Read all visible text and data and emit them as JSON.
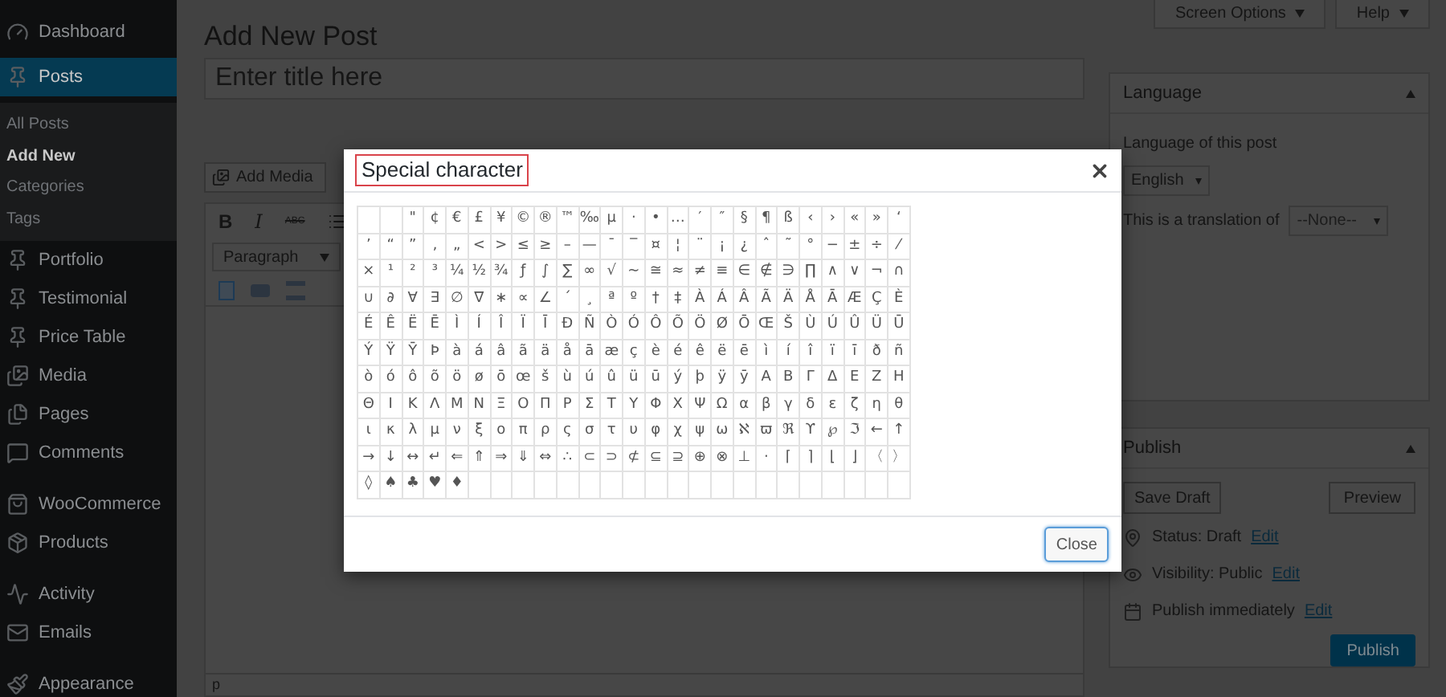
{
  "sidebar": {
    "items": [
      {
        "label": "Dashboard",
        "selected": false
      },
      {
        "label": "Posts",
        "selected": true,
        "children": [
          {
            "label": "All Posts",
            "selected": false
          },
          {
            "label": "Add New",
            "selected": true
          },
          {
            "label": "Categories",
            "selected": false
          },
          {
            "label": "Tags",
            "selected": false
          }
        ]
      },
      {
        "label": "Portfolio",
        "selected": false
      },
      {
        "label": "Testimonial",
        "selected": false
      },
      {
        "label": "Price Table",
        "selected": false
      },
      {
        "label": "Media",
        "selected": false
      },
      {
        "label": "Pages",
        "selected": false
      },
      {
        "label": "Comments",
        "selected": false
      },
      {
        "label": "WooCommerce",
        "selected": false
      },
      {
        "label": "Products",
        "selected": false
      },
      {
        "label": "Activity",
        "selected": false
      },
      {
        "label": "Emails",
        "selected": false
      },
      {
        "label": "Appearance",
        "selected": false
      }
    ]
  },
  "top_buttons": [
    "Screen Options",
    "Help"
  ],
  "page_title": "Add New Post",
  "title_field": {
    "placeholder": "Enter title here"
  },
  "add_media": "Add Media",
  "toolbar": {
    "bold": "B",
    "italic": "I",
    "strike": "ABC",
    "format_select": "Paragraph"
  },
  "editor_path": "p",
  "language_panel": {
    "title": "Language",
    "label": "Language of this post",
    "language": "English",
    "translation_label": "This is a translation of",
    "translation": "--None--"
  },
  "publish_panel": {
    "title": "Publish",
    "save_draft": "Save Draft",
    "preview": "Preview",
    "status": {
      "text": "Status: Draft",
      "link": "Edit"
    },
    "visibility": {
      "text": "Visibility: Public",
      "link": "Edit"
    },
    "schedule": {
      "text": "Publish immediately",
      "link": "Edit"
    },
    "publish": "Publish"
  },
  "dialog": {
    "title": "Special character",
    "close": "Close",
    "rows": [
      [
        "",
        "",
        "\"",
        "¢",
        "€",
        "£",
        "¥",
        "©",
        "®",
        "™",
        "‰",
        "µ",
        "·",
        "•",
        "…",
        "′",
        "″",
        "§",
        "¶",
        "ß",
        "‹",
        "›",
        "«",
        "»",
        "‘"
      ],
      [
        "’",
        "“",
        "”",
        "‚",
        "„",
        "<",
        ">",
        "≤",
        "≥",
        "–",
        "—",
        "¯",
        "‾",
        "¤",
        "¦",
        "¨",
        "¡",
        "¿",
        "ˆ",
        "˜",
        "°",
        "−",
        "±",
        "÷",
        "⁄"
      ],
      [
        "×",
        "¹",
        "²",
        "³",
        "¼",
        "½",
        "¾",
        "ƒ",
        "∫",
        "∑",
        "∞",
        "√",
        "∼",
        "≅",
        "≈",
        "≠",
        "≡",
        "∈",
        "∉",
        "∋",
        "∏",
        "∧",
        "∨",
        "¬",
        "∩"
      ],
      [
        "∪",
        "∂",
        "∀",
        "∃",
        "∅",
        "∇",
        "∗",
        "∝",
        "∠",
        "´",
        "¸",
        "ª",
        "º",
        "†",
        "‡",
        "À",
        "Á",
        "Â",
        "Ã",
        "Ä",
        "Å",
        "Ā",
        "Æ",
        "Ç",
        "È"
      ],
      [
        "É",
        "Ê",
        "Ë",
        "Ē",
        "Ì",
        "Í",
        "Î",
        "Ï",
        "Ī",
        "Ð",
        "Ñ",
        "Ò",
        "Ó",
        "Ô",
        "Õ",
        "Ö",
        "Ø",
        "Ō",
        "Œ",
        "Š",
        "Ù",
        "Ú",
        "Û",
        "Ü",
        "Ū"
      ],
      [
        "Ý",
        "Ÿ",
        "Ȳ",
        "Þ",
        "à",
        "á",
        "â",
        "ã",
        "ä",
        "å",
        "ā",
        "æ",
        "ç",
        "è",
        "é",
        "ê",
        "ë",
        "ē",
        "ì",
        "í",
        "î",
        "ï",
        "ī",
        "ð",
        "ñ"
      ],
      [
        "ò",
        "ó",
        "ô",
        "õ",
        "ö",
        "ø",
        "ō",
        "œ",
        "š",
        "ù",
        "ú",
        "û",
        "ü",
        "ū",
        "ý",
        "þ",
        "ÿ",
        "ȳ",
        "Α",
        "Β",
        "Γ",
        "Δ",
        "Ε",
        "Ζ",
        "Η"
      ],
      [
        "Θ",
        "Ι",
        "Κ",
        "Λ",
        "Μ",
        "Ν",
        "Ξ",
        "Ο",
        "Π",
        "Ρ",
        "Σ",
        "Τ",
        "Υ",
        "Φ",
        "Χ",
        "Ψ",
        "Ω",
        "α",
        "β",
        "γ",
        "δ",
        "ε",
        "ζ",
        "η",
        "θ"
      ],
      [
        "ι",
        "κ",
        "λ",
        "μ",
        "ν",
        "ξ",
        "ο",
        "π",
        "ρ",
        "ς",
        "σ",
        "τ",
        "υ",
        "φ",
        "χ",
        "ψ",
        "ω",
        "ℵ",
        "ϖ",
        "ℜ",
        "ϒ",
        "℘",
        "ℑ",
        "←",
        "↑"
      ],
      [
        "→",
        "↓",
        "↔",
        "↵",
        "⇐",
        "⇑",
        "⇒",
        "⇓",
        "⇔",
        "∴",
        "⊂",
        "⊃",
        "⊄",
        "⊆",
        "⊇",
        "⊕",
        "⊗",
        "⊥",
        "⋅",
        "⌈",
        "⌉",
        "⌊",
        "⌋",
        "〈",
        "〉"
      ],
      [
        "◊",
        "♠",
        "♣",
        "♥",
        "♦",
        "",
        "",
        "",
        "",
        "",
        "",
        "",
        "",
        "",
        "",
        "",
        "",
        "",
        "",
        "",
        "",
        "",
        "",
        "",
        ""
      ]
    ]
  }
}
